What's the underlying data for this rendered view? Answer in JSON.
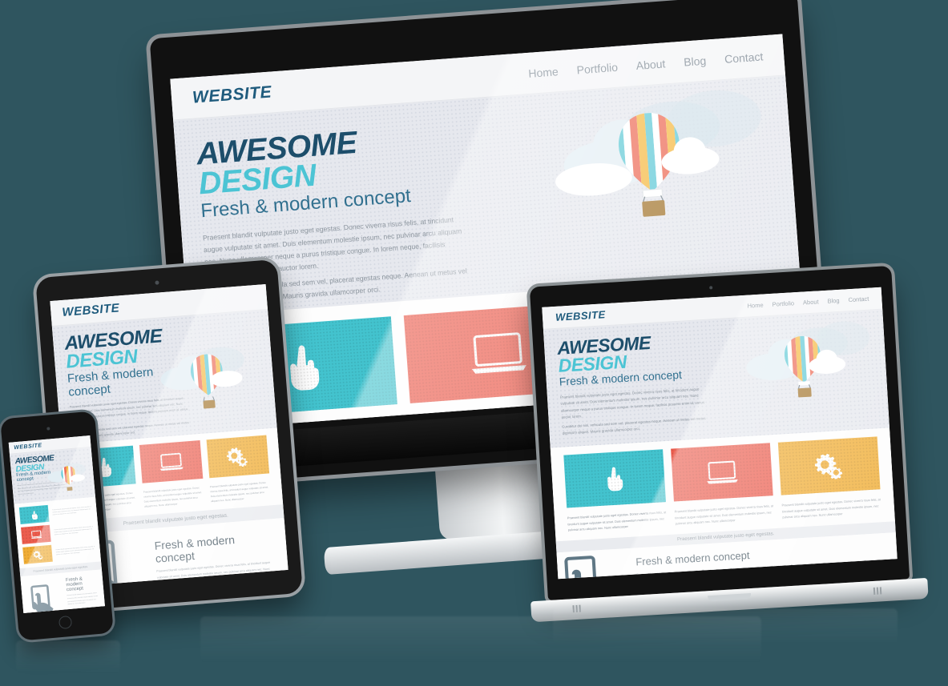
{
  "background_color": "#2f555f",
  "brand": {
    "logo": "WEBSITE",
    "logo_color": "#1f5b7d",
    "headline_top": "AWESOME",
    "headline_bottom": "DESIGN",
    "headline_top_color": "#1d4e6b",
    "headline_bottom_color": "#4cc4d4",
    "tagline": "Fresh & modern concept"
  },
  "nav": {
    "items": [
      {
        "label": "Home"
      },
      {
        "label": "Portfolio"
      },
      {
        "label": "About"
      },
      {
        "label": "Blog"
      },
      {
        "label": "Contact"
      }
    ]
  },
  "hero": {
    "paragraph_1": "Praesent blandit vulputate justo eget egestas. Donec viverra risus felis, at tincidunt augue vulputate sit amet. Duis elementum molestie ipsum, nec pulvinar arcu aliquam nec. Nunc ullamcorper neque a purus tristique congue. In lorem neque, facilisis posuere enim id, varius auctor lorem.",
    "paragraph_2": "Curabitur dui nisi, vehicula sed sem vel, placerat egestas neque. Aenean ut metus vel metus dignissim aliquet. Mauris gravida ullamcorper orci.",
    "illustration": "hot-air-balloon-with-clouds"
  },
  "tiles": [
    {
      "icon": "pointing-hand-icon",
      "color": "#43c3ce",
      "caption": "Praesent blandit vulputate justo eget egestas. Donec viverra risus felis, at tincidunt augue vulputate sit amet. Duis elementum molestie ipsum, nec pulvinar arcu aliquam nec. Nunc ullamcorper"
    },
    {
      "icon": "laptop-icon",
      "color": "#ec5d4e",
      "caption": "Praesent blandit vulputate justo eget egestas. Donec viverra risus felis, at tincidunt augue vulputate sit amet. Duis elementum molestie ipsum, nec pulvinar arcu aliquam nec. Nunc ullamcorper"
    },
    {
      "icon": "gears-icon",
      "color": "#f0ad35",
      "caption": "Praesent blandit vulputate justo eget egestas. Donec viverra risus felis, at tincidunt augue vulputate sit amet. Duis elementum molestie ipsum, nec pulvinar arcu aliquam nec. Nunc ullamcorper"
    }
  ],
  "band": {
    "text": "Praesent blandit vulputate justo eget egestas."
  },
  "lower_section": {
    "heading": "Fresh & modern concept",
    "paragraph": "Praesent blandit vulputate justo eget egestas. Donec viverra risus felis, at tincidunt augue vulputate sit amet. Duis elementum molestie ipsum, nec pulvinar arcu aliquam nec. Nunc ullamcorper",
    "illustration": "hand-tapping-tablet-icon"
  },
  "devices": [
    {
      "name": "desktop-monitor"
    },
    {
      "name": "tablet"
    },
    {
      "name": "smartphone"
    },
    {
      "name": "laptop"
    }
  ]
}
